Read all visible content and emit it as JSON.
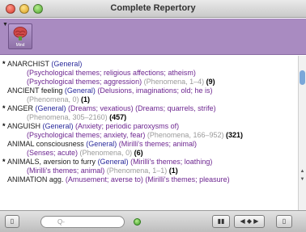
{
  "window": {
    "title": "Complete Repertory"
  },
  "toolbar": {
    "mind_label": "Mind"
  },
  "rubrics": [
    {
      "lines": [
        [
          {
            "t": "bullet",
            "v": "* "
          },
          {
            "t": "main",
            "v": "ANARCHIST"
          },
          {
            "t": "blue",
            "v": " (General)"
          }
        ],
        [
          {
            "t": "purple",
            "v": "(Psychological themes; religious affections; atheism)"
          }
        ],
        [
          {
            "t": "purple",
            "v": "(Psychological themes; aggression)"
          },
          {
            "t": "gray",
            "v": " (Phenomena, 1–4)"
          },
          {
            "t": "count",
            "v": " (9)"
          }
        ]
      ]
    },
    {
      "lines": [
        [
          {
            "t": "main",
            "v": "ANCIENT feeling"
          },
          {
            "t": "blue",
            "v": " (General)"
          },
          {
            "t": "purple",
            "v": " (Delusions, imaginations; old; he is)"
          }
        ],
        [
          {
            "t": "gray",
            "v": "(Phenomena, 0)"
          },
          {
            "t": "count",
            "v": " (1)"
          }
        ]
      ]
    },
    {
      "lines": [
        [
          {
            "t": "bullet",
            "v": "* "
          },
          {
            "t": "main",
            "v": "ANGER"
          },
          {
            "t": "blue",
            "v": " (General)"
          },
          {
            "t": "purple",
            "v": " (Dreams; vexatious) (Dreams; quarrels, strife)"
          }
        ],
        [
          {
            "t": "gray",
            "v": "(Phenomena, 305–2160)"
          },
          {
            "t": "count",
            "v": " (457)"
          }
        ]
      ]
    },
    {
      "lines": [
        [
          {
            "t": "bullet",
            "v": "* "
          },
          {
            "t": "main",
            "v": "ANGUISH"
          },
          {
            "t": "blue",
            "v": " (General)"
          },
          {
            "t": "purple",
            "v": " (Anxiety; periodic paroxysms of)"
          }
        ],
        [
          {
            "t": "purple",
            "v": "(Psychological themes; anxiety, fear)"
          },
          {
            "t": "gray",
            "v": " (Phenomena, 166–952)"
          },
          {
            "t": "count",
            "v": " (321)"
          }
        ]
      ]
    },
    {
      "lines": [
        [
          {
            "t": "main",
            "v": "ANIMAL consciousness"
          },
          {
            "t": "blue",
            "v": " (General)"
          },
          {
            "t": "purple",
            "v": " (Mirilli's themes; animal)"
          }
        ],
        [
          {
            "t": "purple",
            "v": "(Senses; acute)"
          },
          {
            "t": "gray",
            "v": " (Phenomena, 0)"
          },
          {
            "t": "count",
            "v": " (6)"
          }
        ]
      ]
    },
    {
      "lines": [
        [
          {
            "t": "bullet",
            "v": "* "
          },
          {
            "t": "main",
            "v": "ANIMALS, aversion to furry"
          },
          {
            "t": "blue",
            "v": " (General)"
          },
          {
            "t": "purple",
            "v": " (Mirilli's themes; loathing)"
          }
        ],
        [
          {
            "t": "purple",
            "v": "(Mirilli's themes; animal)"
          },
          {
            "t": "gray",
            "v": " (Phenomena, 1–1)"
          },
          {
            "t": "count",
            "v": " (1)"
          }
        ]
      ]
    },
    {
      "lines": [
        [
          {
            "t": "main",
            "v": "ANIMATION agg."
          },
          {
            "t": "purple",
            "v": " (Amusement; averse to) (Mirilli's themes; pleasure)"
          }
        ]
      ]
    }
  ],
  "bottombar": {
    "search_placeholder": "Q-",
    "left_button_label": "▯",
    "list_button_label": "▮▮",
    "nav_button_label": "◀ ◆ ▶",
    "right_button_label": "▯"
  }
}
